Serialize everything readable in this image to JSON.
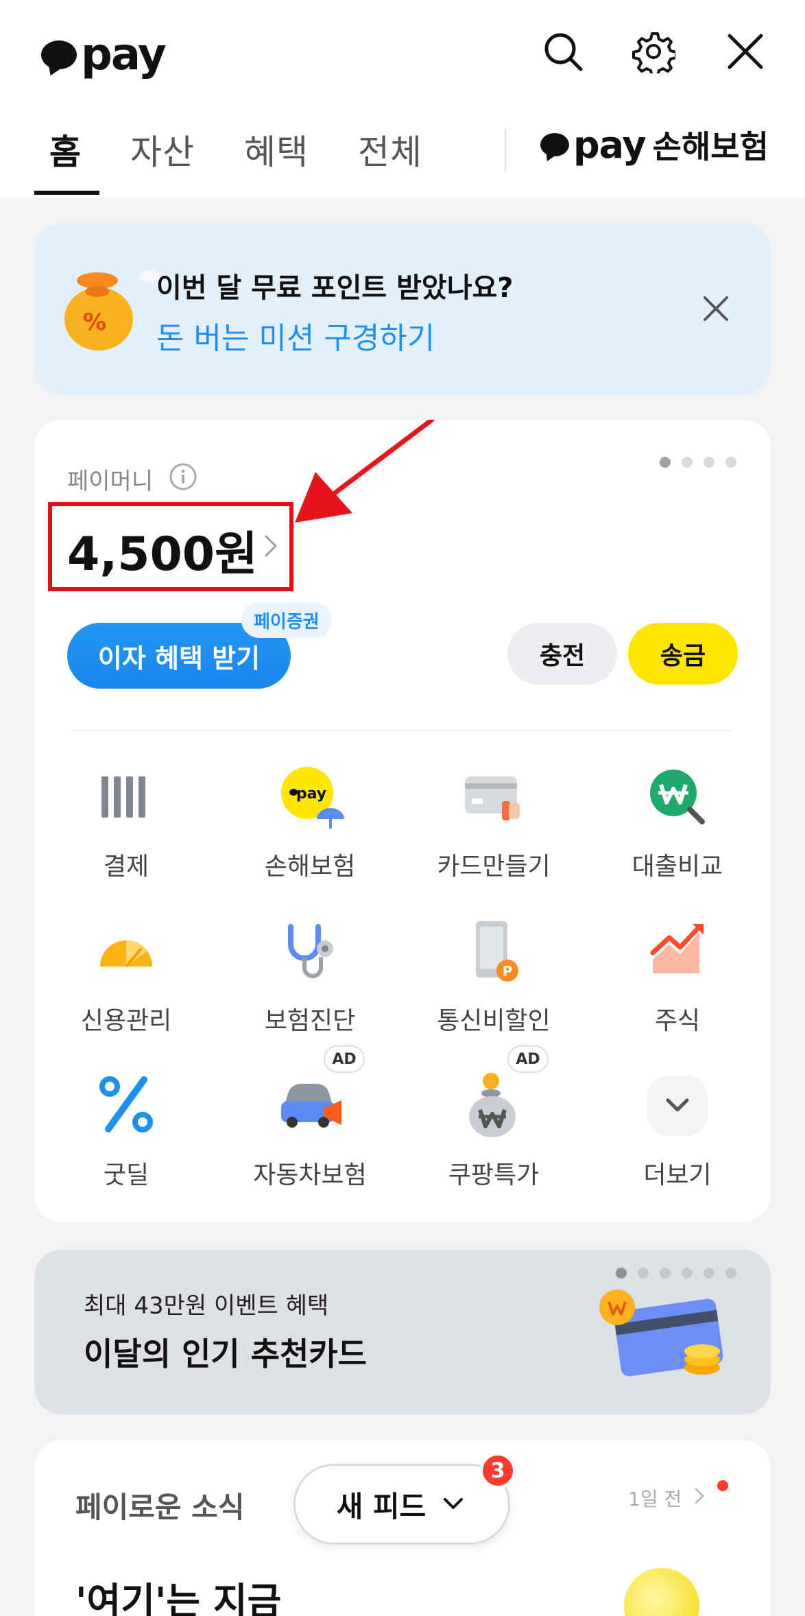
{
  "header": {
    "logo_text": "pay",
    "tabs": [
      {
        "label": "홈",
        "active": true
      },
      {
        "label": "자산",
        "active": false
      },
      {
        "label": "혜택",
        "active": false
      },
      {
        "label": "전체",
        "active": false
      }
    ],
    "insurance_link": {
      "logo_text": "pay",
      "label": "손해보험"
    },
    "icons": [
      "search-icon",
      "gear-icon",
      "close-icon"
    ]
  },
  "banner": {
    "title": "이번 달 무료 포인트 받았나요?",
    "subtitle": "돈 버는 미션 구경하기",
    "bag_glyph": "%"
  },
  "paymoney": {
    "label": "페이머니",
    "balance": "4,500원",
    "page_dots": {
      "count": 4,
      "active": 0
    },
    "interest_button": "이자 혜택 받기",
    "securities_badge": "페이증권",
    "charge_button": "충전",
    "send_button": "송금"
  },
  "services": [
    {
      "label": "결제",
      "icon": "barcode-icon"
    },
    {
      "label": "손해보험",
      "icon": "pay-insurance-icon",
      "icon_text": "pay"
    },
    {
      "label": "카드만들기",
      "icon": "card-icon"
    },
    {
      "label": "대출비교",
      "icon": "loan-compare-icon"
    },
    {
      "label": "신용관리",
      "icon": "credit-gauge-icon"
    },
    {
      "label": "보험진단",
      "icon": "stethoscope-icon"
    },
    {
      "label": "통신비할인",
      "icon": "phone-discount-icon",
      "icon_text": "P"
    },
    {
      "label": "주식",
      "icon": "stock-chart-icon"
    },
    {
      "label": "굿딜",
      "icon": "percent-icon"
    },
    {
      "label": "자동차보험",
      "icon": "car-insurance-icon",
      "ad": "AD"
    },
    {
      "label": "쿠팡특가",
      "icon": "money-bag-icon",
      "ad": "AD"
    },
    {
      "label": "더보기",
      "icon": "chevron-down-icon"
    }
  ],
  "promo": {
    "subtitle": "최대 43만원 이벤트 혜택",
    "title": "이달의 인기 추천카드",
    "page_dots": {
      "count": 6,
      "active": 0
    }
  },
  "news": {
    "title": "페이로운 소식",
    "time": "1일 전",
    "headline": "'여기'는 지금"
  },
  "feed": {
    "label": "새 피드",
    "badge": "3"
  },
  "colors": {
    "accent_blue": "#1f8ff0",
    "send_yellow": "#fde500",
    "highlight_red": "#e0101a",
    "banner_bg": "#e3f0fc"
  }
}
